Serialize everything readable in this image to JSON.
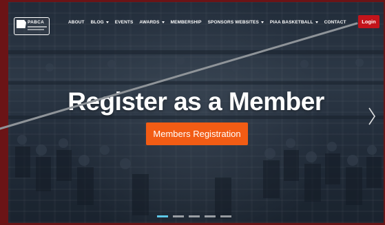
{
  "logo": {
    "text": "PABCA"
  },
  "nav": {
    "items": [
      {
        "label": "ABOUT",
        "dropdown": false
      },
      {
        "label": "BLOG",
        "dropdown": true
      },
      {
        "label": "EVENTS",
        "dropdown": false
      },
      {
        "label": "AWARDS",
        "dropdown": true
      },
      {
        "label": "MEMBERSHIP",
        "dropdown": false
      },
      {
        "label": "SPONSORS WEBSITES",
        "dropdown": true
      },
      {
        "label": "PIAA BASKETBALL",
        "dropdown": true
      },
      {
        "label": "CONTACT",
        "dropdown": false
      }
    ],
    "login_label": "Login"
  },
  "hero": {
    "headline": "Register as a Member",
    "cta_label": "Members Registration",
    "slides": 5,
    "active_slide": 1
  },
  "colors": {
    "frame": "#6b1416",
    "login": "#c3141b",
    "cta": "#f25c14",
    "active_dot": "#5ec8e8",
    "annotation_line": "#8f9499"
  }
}
